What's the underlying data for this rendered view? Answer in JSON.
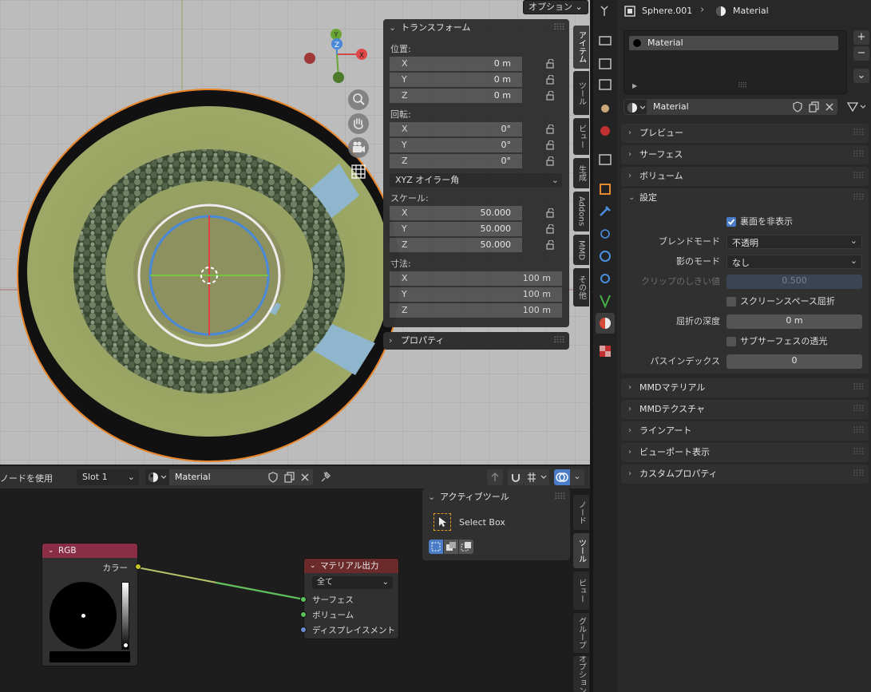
{
  "viewport": {
    "options_label": "オプション",
    "tabs": [
      "アイテム",
      "ツール",
      "ビュー",
      "生成",
      "Addons",
      "MMD",
      "その他"
    ],
    "gizmo_axes": {
      "x": "X",
      "y": "Y",
      "z": "Z"
    }
  },
  "transform_panel": {
    "title": "トランスフォーム",
    "location_label": "位置:",
    "location": [
      {
        "axis": "X",
        "value": "0 m"
      },
      {
        "axis": "Y",
        "value": "0 m"
      },
      {
        "axis": "Z",
        "value": "0 m"
      }
    ],
    "rotation_label": "回転:",
    "rotation": [
      {
        "axis": "X",
        "value": "0°"
      },
      {
        "axis": "Y",
        "value": "0°"
      },
      {
        "axis": "Z",
        "value": "0°"
      }
    ],
    "rotation_mode": "XYZ オイラー角",
    "scale_label": "スケール:",
    "scale": [
      {
        "axis": "X",
        "value": "50.000"
      },
      {
        "axis": "Y",
        "value": "50.000"
      },
      {
        "axis": "Z",
        "value": "50.000"
      }
    ],
    "dimensions_label": "寸法:",
    "dimensions": [
      {
        "axis": "X",
        "value": "100 m"
      },
      {
        "axis": "Y",
        "value": "100 m"
      },
      {
        "axis": "Z",
        "value": "100 m"
      }
    ],
    "properties_title": "プロパティ"
  },
  "node_header": {
    "use_nodes": "ノードを使用",
    "slot": "Slot 1",
    "material": "Material"
  },
  "node_sidebar": {
    "title": "アクティブツール",
    "tool": "Select Box",
    "tabs": [
      "ノード",
      "ツール",
      "ビュー",
      "グループ",
      "オプション"
    ]
  },
  "nodes": {
    "rgb": {
      "title": "RGB",
      "output": "カラー"
    },
    "output": {
      "title": "マテリアル出力",
      "target": "全て",
      "inputs": [
        "サーフェス",
        "ボリューム",
        "ディスプレイスメント"
      ]
    }
  },
  "properties": {
    "breadcrumb": {
      "object": "Sphere.001",
      "material": "Material"
    },
    "slot_name": "Material",
    "material_name": "Material",
    "sections_top": [
      "プレビュー",
      "サーフェス",
      "ボリューム"
    ],
    "settings": {
      "title": "設定",
      "backface_culling": "裏面を非表示",
      "blend_mode_label": "ブレンドモード",
      "blend_mode": "不透明",
      "shadow_mode_label": "影のモード",
      "shadow_mode": "なし",
      "clip_threshold_label": "クリップのしきい値",
      "clip_threshold": "0.500",
      "ssr": "スクリーンスペース屈折",
      "refraction_depth_label": "屈折の深度",
      "refraction_depth": "0 m",
      "sss_translucency": "サブサーフェスの透光",
      "pass_index_label": "パスインデックス",
      "pass_index": "0"
    },
    "sections_bottom": [
      "MMDマテリアル",
      "MMDテクスチャ",
      "ラインアート",
      "ビューポート表示",
      "カスタムプロパティ"
    ]
  }
}
